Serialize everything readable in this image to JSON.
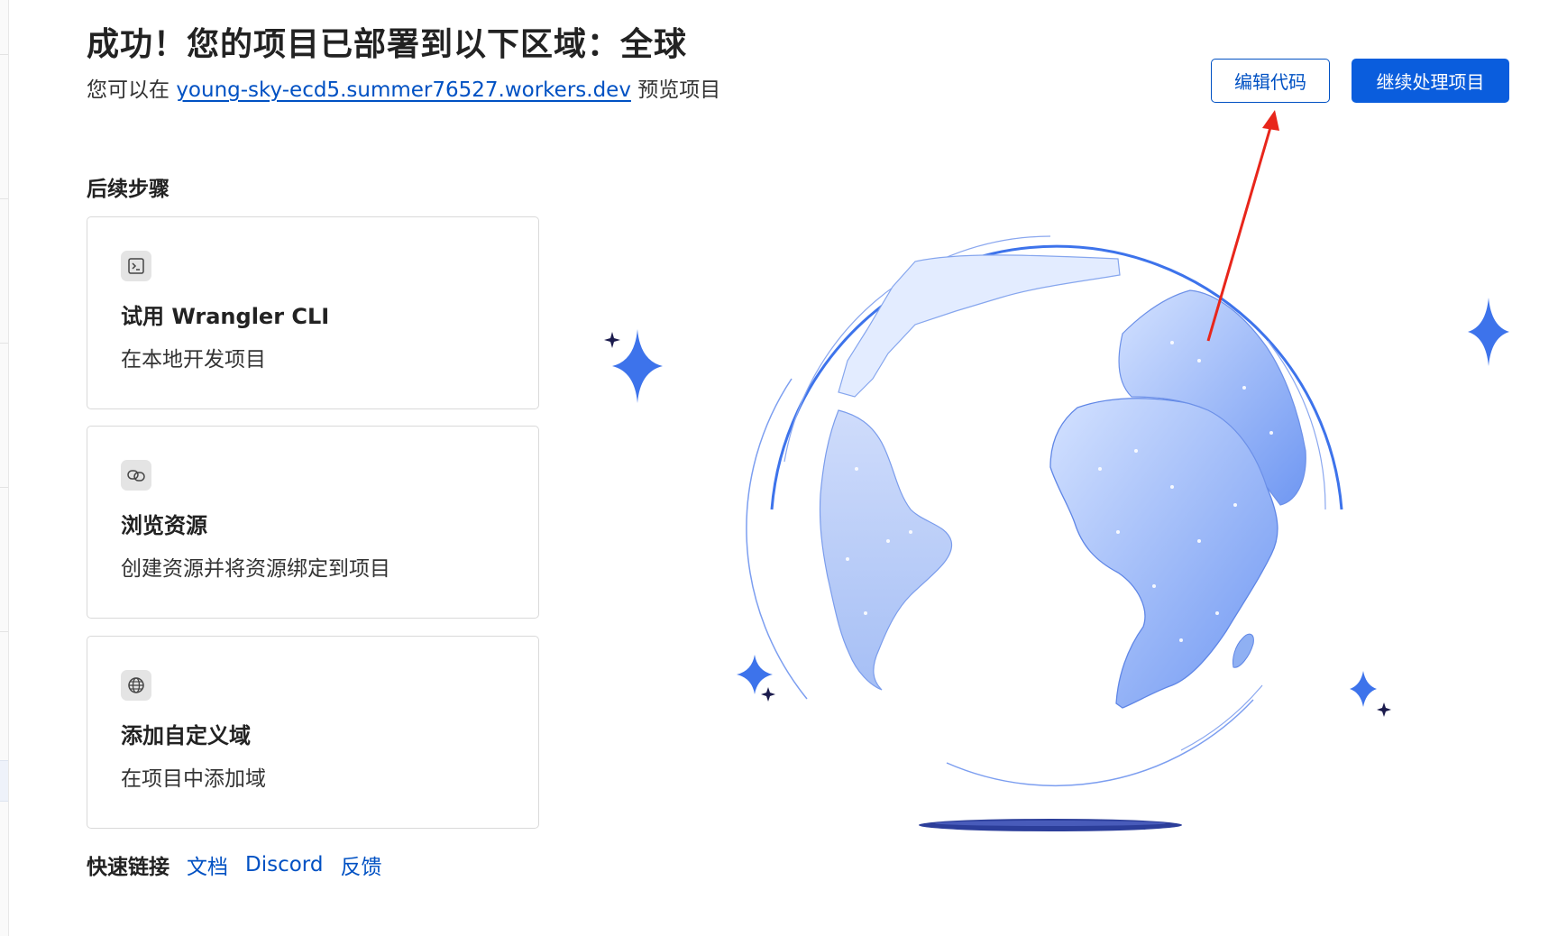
{
  "header": {
    "title": "成功！您的项目已部署到以下区域：全球",
    "preview_prefix": "您可以在",
    "preview_url": "young-sky-ecd5.summer76527.workers.dev",
    "preview_suffix": "预览项目"
  },
  "actions": {
    "edit_code": "编辑代码",
    "continue_project": "继续处理项目"
  },
  "next_steps": {
    "heading": "后续步骤",
    "cards": [
      {
        "icon": "terminal-icon",
        "title": "试用 Wrangler CLI",
        "description": "在本地开发项目"
      },
      {
        "icon": "link-icon",
        "title": "浏览资源",
        "description": "创建资源并将资源绑定到项目"
      },
      {
        "icon": "globe-icon",
        "title": "添加自定义域",
        "description": "在项目中添加域"
      }
    ]
  },
  "quick_links": {
    "label": "快速链接",
    "links": [
      "文档",
      "Discord",
      "反馈"
    ]
  },
  "colors": {
    "accent": "#0051c3",
    "primary_button": "#0a5ddd",
    "annotation_arrow": "#e8261b"
  }
}
